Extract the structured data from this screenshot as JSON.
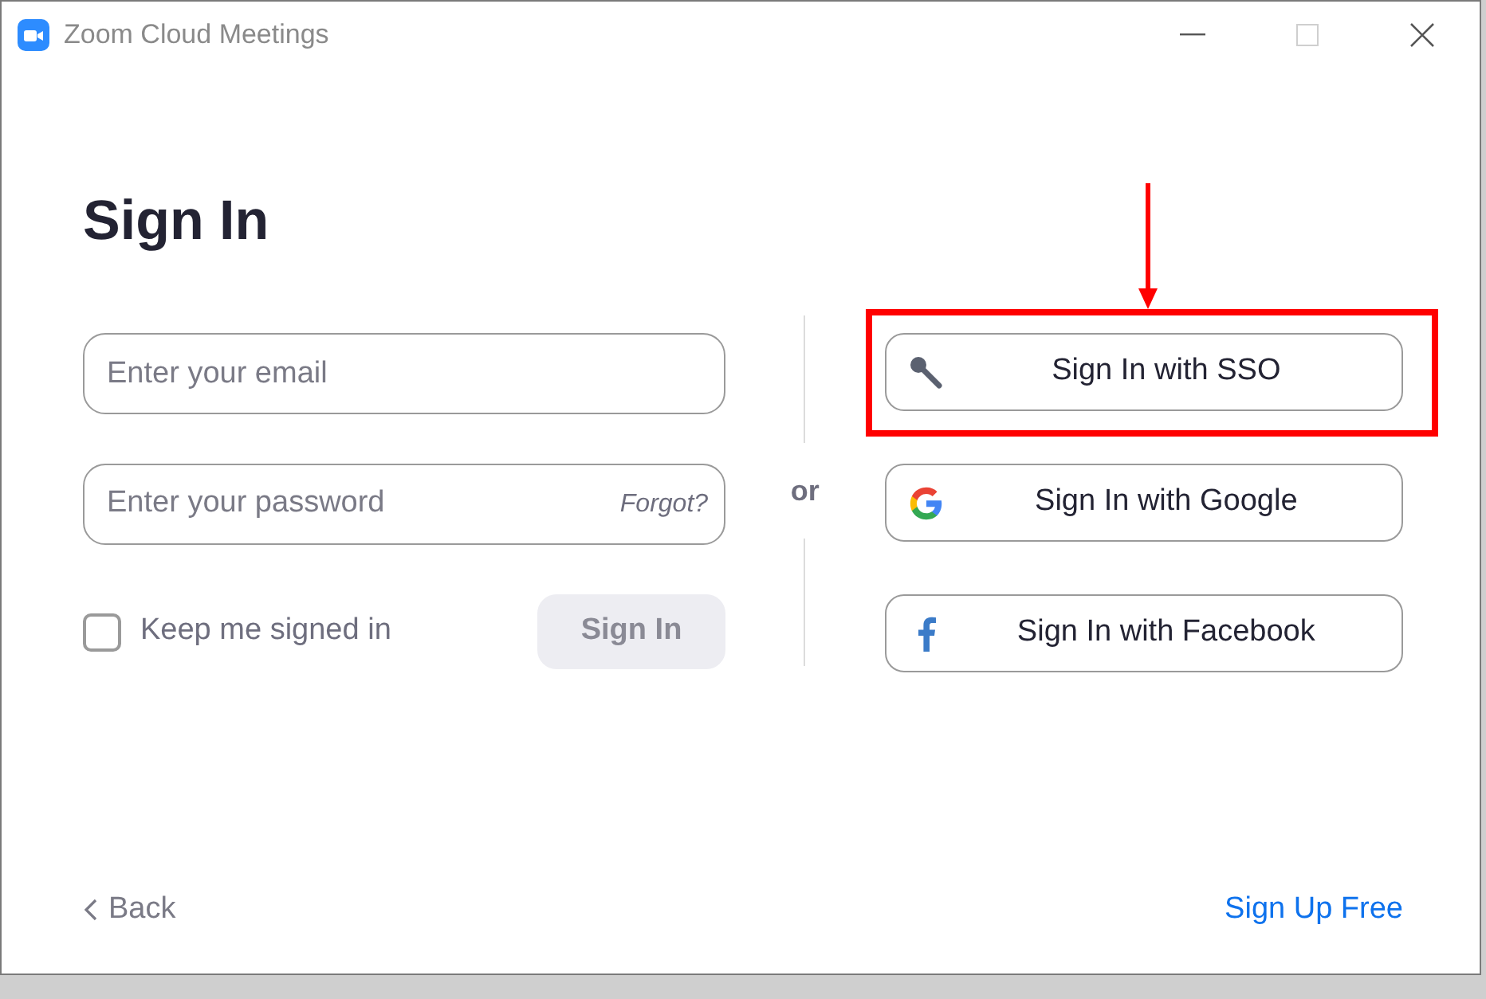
{
  "window": {
    "title": "Zoom Cloud Meetings"
  },
  "heading": "Sign In",
  "email_field": {
    "placeholder": "Enter your email"
  },
  "password_field": {
    "placeholder": "Enter your password",
    "forgot_link": "Forgot?"
  },
  "keep_signed_in": {
    "label": "Keep me signed in",
    "checked": false
  },
  "sign_in_button": {
    "label": "Sign In",
    "disabled": true
  },
  "separator": "or",
  "sso_buttons": [
    {
      "kind": "sso",
      "label": "Sign In with SSO",
      "highlighted": true
    },
    {
      "kind": "google",
      "label": "Sign In with Google",
      "highlighted": false
    },
    {
      "kind": "facebook",
      "label": "Sign In with Facebook",
      "highlighted": false
    }
  ],
  "back_link": "Back",
  "sign_up_link": "Sign Up Free"
}
